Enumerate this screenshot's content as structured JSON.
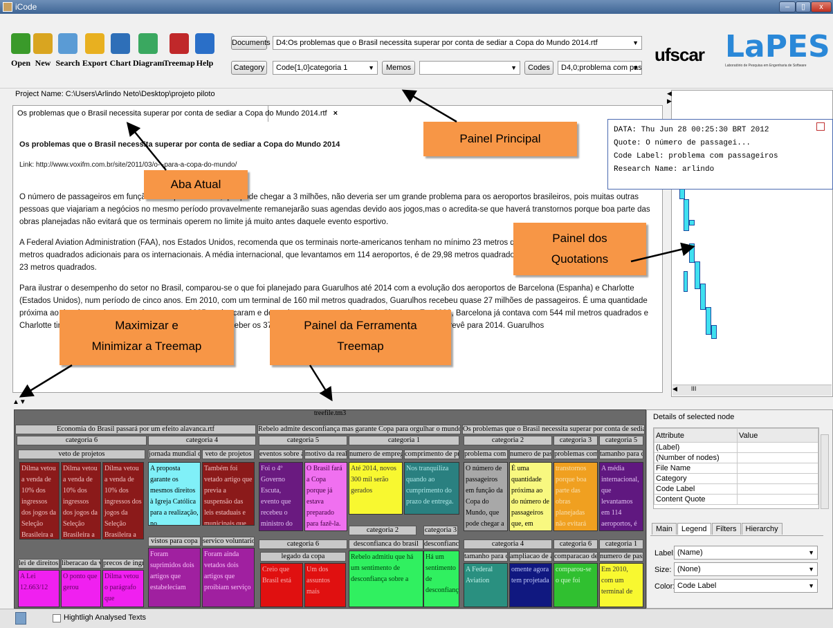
{
  "window": {
    "title": "iCode",
    "min": "–",
    "max": "▯",
    "close": "x"
  },
  "toolbar": {
    "buttons": [
      {
        "label": "Open",
        "color": "#3a9a2a"
      },
      {
        "label": "New",
        "color": "#d9a520"
      },
      {
        "label": "Search",
        "color": "#5a9bd5"
      },
      {
        "label": "Export",
        "color": "#e8b020"
      },
      {
        "label": "Chart",
        "color": "#2e6fb8"
      },
      {
        "label": "Diagram",
        "color": "#3aa860"
      },
      {
        "label": "Treemap",
        "color": "#c0282a"
      },
      {
        "label": "Help",
        "color": "#2a6fc8"
      }
    ],
    "documents_label": "Documents",
    "documents_value": "D4:Os problemas que o Brasil necessita superar por conta de sediar a Copa do Mundo 2014.rtf",
    "category_label": "Category",
    "category_value": "Code{1,0}categoria 1",
    "memos_label": "Memos",
    "memos_value": "",
    "codes_label": "Codes",
    "codes_value": "D4,0;problema com passa...",
    "logo_ufscar": "ufscar",
    "logo_lapes": "LaPES",
    "logo_sub": "Laboratório de Pesquisa em Engenharia de Software"
  },
  "project_name": "Project Name: C:\\Users\\Arlindo Neto\\Desktop\\projeto piloto",
  "tab": {
    "label": "Os problemas que o Brasil necessita superar por conta de sediar a Copa do Mundo 2014.rtf",
    "close": "×"
  },
  "doc": {
    "title": "Os problemas que o Brasil necessita superar por conta de sediar a Copa do Mundo 2014",
    "link": "Link: http://www.voxifm.com.br/site/2011/03/o-                                      -para-a-copa-do-mundo/",
    "p1": "O número de passageiros em função da Copa do Mundo, que pode chegar a 3 milhões, não deveria ser um grande problema para os aeroportos brasileiros, pois muitas outras pessoas que viajariam a negócios no mesmo período provavelmente remanejarão suas agendas devido aos jogos,mas o acredita-se que haverá transtornos porque boa parte das obras planejadas não evitará que os terminais operem no limite já muito antes daquele evento esportivo.",
    "p2": "A Federal Aviation Administration (FAA), nos Estados Unidos, recomenda que os terminais norte-americanos tenham no mínimo 23 metros quadrados disponíveis para cad                                                   14 metros quadrados adicionais para os internacionais. A média internacional, que levantamos em 114 aeroportos, é de 29,98 metros quadrados por passageiro na hora-p                                                  abaixo de 23 metros quadrados.",
    "p3": "Para ilustrar o desempenho do setor no Brasil, comparou-se o que foi planejado para Guarulhos até 2014 com a evolução dos aeroportos de Barcelona (Espanha) e Charlotte (Estados Unidos), num período de cinco anos. Em 2010, com um terminal de 160 mil metros quadrados, Guarulhos recebeu quase 27 milhões de passageiros. É uma quantidade próxima ao do número de passageiros que, em 2005, embarcaram e desembarc                                       metros quadrados de Charlotte. Em 2009, Barcelona já contava com 544 mil metros quadrados e Charlotte tinha 518 mil. Já Guarulhos, somente a                                         quadrado                                                                                           ceber os 37 milhões de passageiros que o estudo da Coppe prevê para 2014.                                          Guarulhos"
  },
  "quote": {
    "line1": "DATA: Thu Jun 28 00:25:30 BRT 2012",
    "line2": "Quote: O número de passagei...",
    "line3": "Code Label: problema com passageiros",
    "line4": "Research Name: arlindo"
  },
  "callouts": {
    "principal": "Painel Principal",
    "aba": "Aba Atual",
    "quot1": "Painel dos",
    "quot2": "Quotations",
    "max1": "Maximizar e",
    "max2": "Minimizar a Treemap",
    "tree1": "Painel da Ferramenta",
    "tree2": "Treemap"
  },
  "treemap": {
    "file": "treefile.tm3",
    "doc1": "Economia do Brasil passará por um efeito alavanca.rtf",
    "doc2": "Rebelo admite desconfiança mas garante Copa para orgulhar o mundo.rtf",
    "doc3": "Os problemas que o Brasil necessita superar por conta de sediar a Copa",
    "headers": {
      "d1c6": "categoria 6",
      "d1c4": "categoria 4",
      "veto1": "veto de projetos",
      "jornada": "jornada mundial da j",
      "veto2": "veto de projetos",
      "vistos": "vistos para copa",
      "servico": "servico voluntario",
      "lei": "lei de direitos c",
      "liberacao": "liberacao da ven",
      "precos": "precos de ingres",
      "d2c5": "categoria 5",
      "d2c1": "categoria 1",
      "eventos": "eventos sobre a",
      "motivo": "motivo da realiz",
      "numero": "numero de empregos",
      "comprimento": "comprimento de pra",
      "d2c2": "categoria 2",
      "d2c3": "categoria 3",
      "desconf1": "desconfianca do brasil",
      "desconf2": "desconfianca",
      "d2c6": "categoria 6",
      "legado": "legado da copa",
      "d3c2": "categoria 2",
      "d3c3": "categoria 3",
      "d3c5": "categoria 5",
      "problema": "problema com p",
      "numpass": "numero de passa",
      "problemas": "problemas com",
      "tamanho": "tamanho para c",
      "d3c4": "categoria 4",
      "d3c6": "categoria 6",
      "d3c1": "categoria 1",
      "tamanho2": "tamanho para ca",
      "ampliacao": "ampliacao de aer",
      "comparacao": "comparacao de",
      "numpass2": "numero de pass"
    },
    "cells": {
      "c1": "Dilma vetou a venda de 10% dos ingressos dos jogos da Seleção Brasileira a",
      "c4": "A proposta garante os mesmos direitos à Igreja Católica para a realização, no",
      "c5": "Também foi vetado artigo que previa a suspensão das leis estaduais e municipais que",
      "c6": "Foram suprimidos dois artigos que estabeleciam",
      "c7": "Foram ainda vetados dois artigos que proibiam serviço",
      "c8": "A Lei 12.663/12",
      "c9": "O ponto que gerou",
      "c10": "Dilma vetou o parágrafo que",
      "c11": "Foi o 4º Governo Escuta, evento que recebeu o ministro do Esporte Aldo",
      "c12": "O Brasil fará a Copa porque já estava preparado para fazê-la. Nós temos que ter",
      "c13": "Até 2014, novos 300 mil serão gerados",
      "c14": "Nos tranquiliza quando ao cumprimento do prazo de entrega.",
      "c15": "Rebelo admitiu que há um sentimento de desconfiança sobre a",
      "c16": "Há um sentimento de desconfianç",
      "c17": "Creio que Brasil está",
      "c18": "Um dos assuntos mais",
      "c19": "O número de passageiros em função da Copa do Mundo, que pode chegar a",
      "c20": "É uma quantidade próxima ao do número de passageiros que, em 2005,",
      "c21": "transtornos porque boa parte das obras planejadas não evitará que os",
      "c22": "A média internacional, que levantamos em 114 aeroportos, é",
      "c23": "A Federal Aviation",
      "c24": "omente agora tem projetada",
      "c25": "comparou-se o que foi",
      "c26": "Em 2010, com um terminal de"
    }
  },
  "details": {
    "title": "Details of selected node",
    "col_attr": "Attribute",
    "col_val": "Value",
    "rows": [
      "(Label)",
      "(Number of nodes)",
      "File Name",
      "Category",
      "Code Label",
      "Content Quote"
    ],
    "tabs": [
      "Main",
      "Legend",
      "Filters",
      "Hierarchy"
    ],
    "label_lbl": "Label:",
    "label_val": "(Name)",
    "size_lbl": "Size:",
    "size_val": "(None)",
    "color_lbl": "Color:",
    "color_val": "Code Label"
  },
  "status": {
    "checkbox": "Hightligh Analysed Texts"
  }
}
